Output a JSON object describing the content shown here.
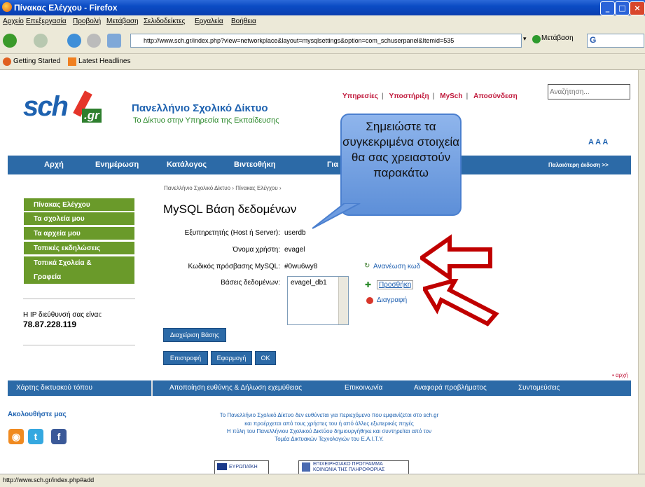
{
  "window": {
    "title": "Πίνακας Ελέγχου - Firefox"
  },
  "menu": [
    "Αρχείο",
    "Επεξεργασία",
    "Προβολή",
    "Μετάβαση",
    "Σελιδοδείκτες",
    "Εργαλεία",
    "Βοήθεια"
  ],
  "nav": {
    "url": "http://www.sch.gr/index.php?view=networkplace&layout=mysqlsettings&option=com_schuserpanel&Itemid=535",
    "go_label": "Μετάβαση",
    "search_value": "G"
  },
  "bookmarks": [
    "Getting Started",
    "Latest Headlines"
  ],
  "site": {
    "logo_main": "sch",
    "logo_suffix": ".gr",
    "brand_title": "Πανελλήνιο Σχολικό Δίκτυο",
    "brand_subtitle": "Το Δίκτυο στην Υπηρεσία της Εκπαίδευσης",
    "top_links": [
      "Υπηρεσίες",
      "Υποστήριξη",
      "MySch",
      "Αποσύνδεση"
    ],
    "search_placeholder": "Αναζήτηση...",
    "font_sizes": "A A A"
  },
  "main_nav": [
    "Αρχή",
    "Ενημέρωση",
    "Κατάλογος",
    "Βιντεοθήκη",
    "Για",
    "Παλαιότερη έκδοση >>"
  ],
  "sidebar": {
    "items": [
      "Πίνακας Ελέγχου",
      "Τα σχολεία μου",
      "Τα αρχεία μου",
      "Τοπικές εκδηλώσεις",
      "Τοπικά Σχολεία & Γραφεία"
    ],
    "ip_label": "Η IP διεύθυνσή σας είναι:",
    "ip_value": "78.87.228.119"
  },
  "content": {
    "breadcrumb": "Πανελλήνιο Σχολικό Δίκτυο  ›  Πίνακας Ελέγχου  ›",
    "title": "MySQL Βάση δεδομένων",
    "fields": [
      {
        "label": "Εξυπηρετητής (Host ή Server):",
        "value": "userdb"
      },
      {
        "label": "Όνομα χρήστη:",
        "value": "evagel"
      },
      {
        "label": "Κωδικός πρόσβασης MySQL:",
        "value": "#0wu6wy8"
      },
      {
        "label": "Βάσεις δεδομένων:",
        "value": ""
      }
    ],
    "databases": [
      "evagel_db1"
    ],
    "refresh_label": "Ανανέωση κωδ",
    "add_label": "Προσθήκη",
    "delete_label": "Διαγραφή",
    "manage_button": "Διαχείριση Βάσης",
    "back_button": "Επιστροφή",
    "apply_button": "Εφαρμογή",
    "ok_button": "OK",
    "top_link": "▪ αρχή"
  },
  "callout": {
    "text": "Σημειώστε τα συγκεκριμένα στοιχεία θα σας χρειαστούν παρακάτω"
  },
  "footer": {
    "links": [
      "Χάρτης δικτυακού τόπου",
      "Αποποίηση ευθύνης & Δήλωση εχεμύθειας",
      "Επικοινωνία",
      "Αναφορά προβλήματος",
      "Συντομεύσεις"
    ],
    "follow": "Ακολουθήστε μας",
    "disclaimer": [
      "Το Πανελλήνιο Σχολικό Δίκτυο δεν ευθύνεται για περιεχόμενο που εμφανίζεται στο sch.gr",
      "και προέρχεται από τους χρήστες του ή από άλλες εξωτερικές πηγές",
      "Η πύλη του Πανελλήνιου Σχολικού Δικτύου δημιουργήθηκε και συντηρείται από τον",
      "Τομέα Δικτυακών Τεχνολογιών του Ε.Α.Ι.Τ.Υ."
    ],
    "eu_label": "ΕΥΡΩΠΑΪΚΗ ΕΝΩΣΗ",
    "program_label_1": "ΕΠΙΧΕΙΡΗΣΙΑΚΟ ΠΡΟΓΡΑΜΜΑ",
    "program_label_2": "ΚΟΙΝΩΝΙΑ ΤΗΣ ΠΛΗΡΟΦΟΡΙΑΣ"
  },
  "status": {
    "text": "http://www.sch.gr/index.php#add"
  }
}
